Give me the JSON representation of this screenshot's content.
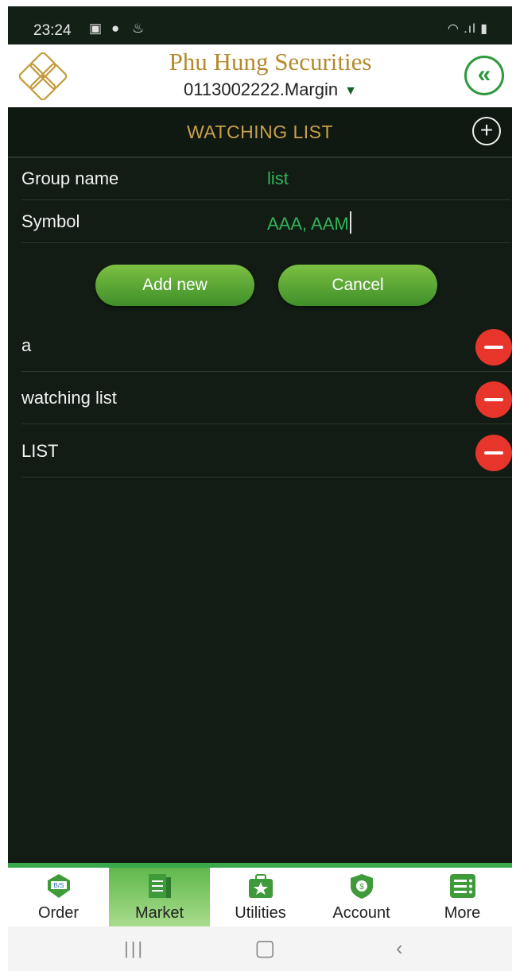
{
  "status_bar": {
    "time": "23:24"
  },
  "header": {
    "brand": "Phu Hung Securities",
    "account": "0113002222.Margin"
  },
  "title_bar": {
    "title": "WATCHING LIST"
  },
  "form": {
    "group_label": "Group name",
    "group_value": "list",
    "symbol_label": "Symbol",
    "symbol_value": "AAA, AAM"
  },
  "buttons": {
    "add_new": "Add new",
    "cancel": "Cancel"
  },
  "watch_lists": [
    {
      "name": "a"
    },
    {
      "name": "watching list"
    },
    {
      "name": "LIST"
    }
  ],
  "bottom_nav": [
    {
      "label": "Order",
      "icon": "order-icon"
    },
    {
      "label": "Market",
      "icon": "market-icon",
      "active": true
    },
    {
      "label": "Utilities",
      "icon": "utilities-icon"
    },
    {
      "label": "Account",
      "icon": "account-icon"
    },
    {
      "label": "More",
      "icon": "more-icon"
    }
  ],
  "colors": {
    "background": "#121c14",
    "accent_green": "#3aa84a",
    "title_gold": "#c9a14a",
    "delete_red": "#e8352c"
  }
}
